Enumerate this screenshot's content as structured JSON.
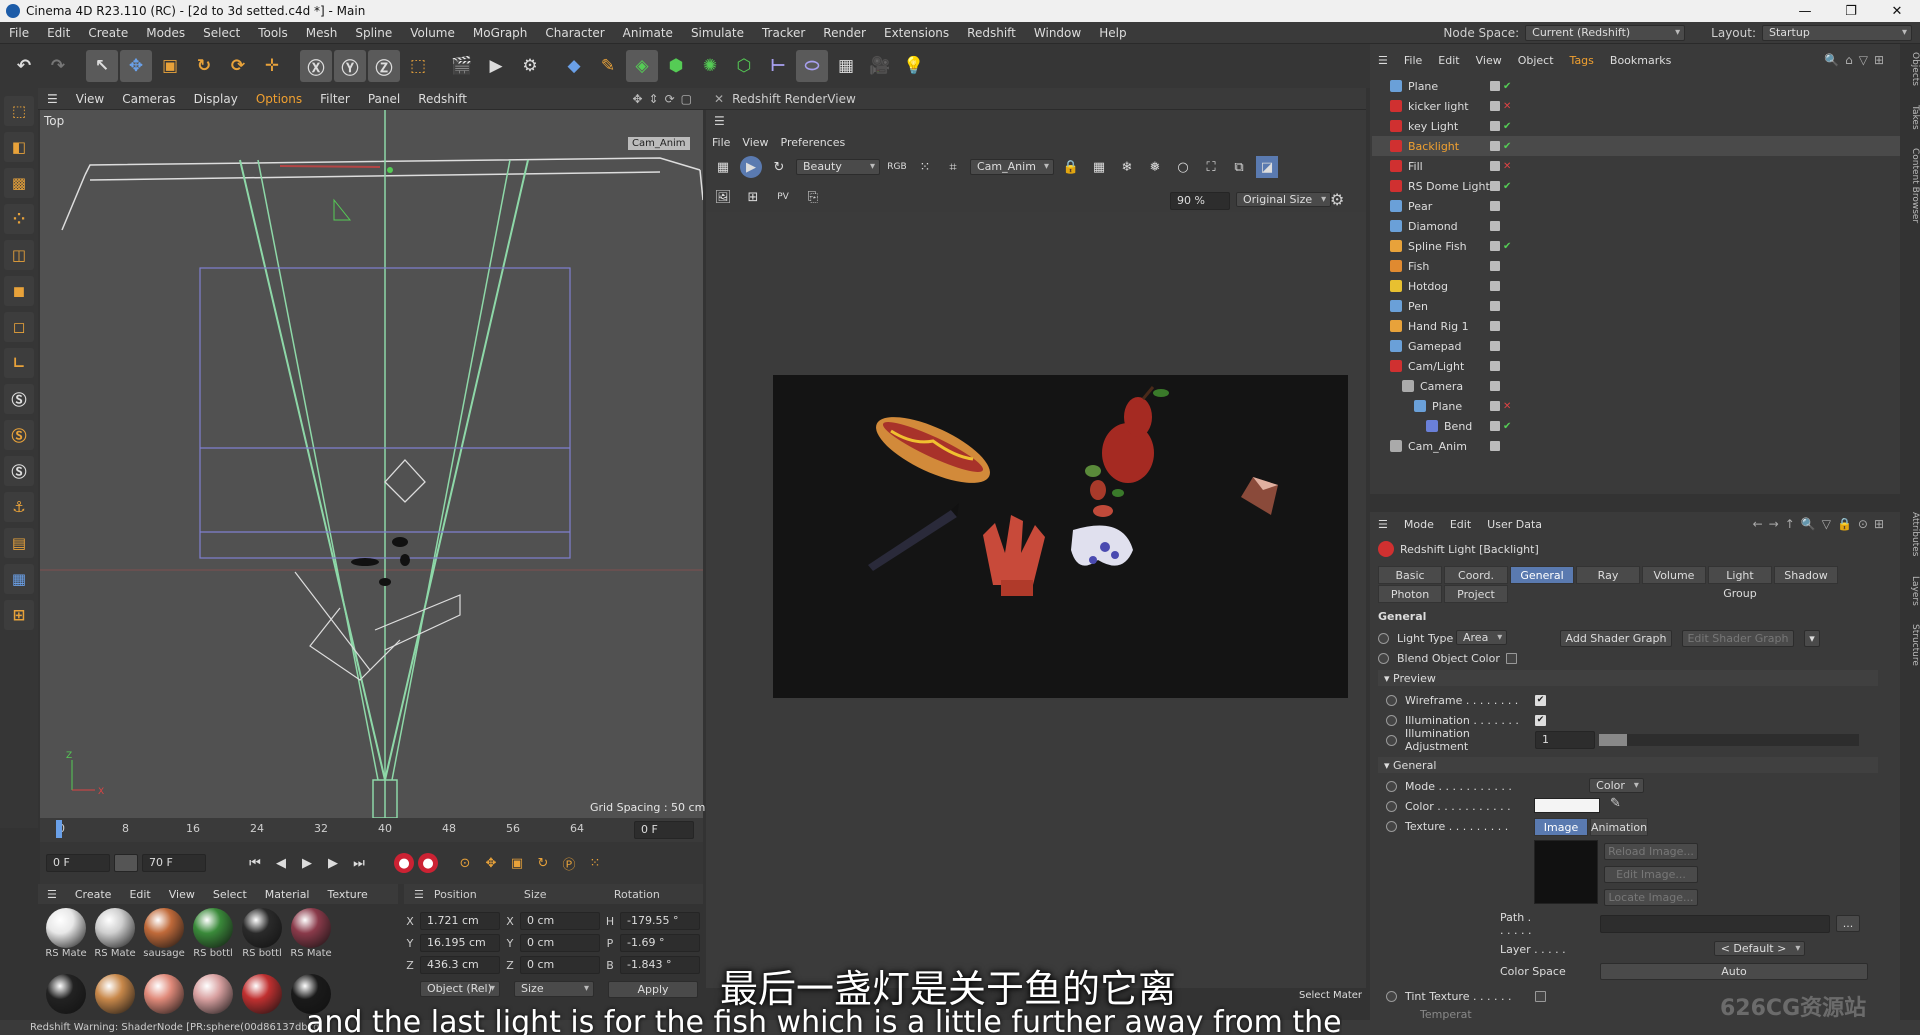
{
  "window": {
    "title": "Cinema 4D R23.110 (RC) - [2d to 3d setted.c4d *] - Main",
    "controls": [
      "—",
      "❐",
      "✕"
    ]
  },
  "menubar": {
    "items": [
      "File",
      "Edit",
      "Create",
      "Modes",
      "Select",
      "Tools",
      "Mesh",
      "Spline",
      "Volume",
      "MoGraph",
      "Character",
      "Animate",
      "Simulate",
      "Tracker",
      "Render",
      "Extensions",
      "Redshift",
      "Window",
      "Help"
    ],
    "node_space_label": "Node Space:",
    "node_space_value": "Current (Redshift)",
    "layout_label": "Layout:",
    "layout_value": "Startup"
  },
  "viewport": {
    "menu": [
      "View",
      "Cameras",
      "Display",
      "Options",
      "Filter",
      "Panel",
      "Redshift"
    ],
    "view_name": "Top",
    "camera_label": "Cam_Anim",
    "grid_spacing": "Grid Spacing : 50 cm"
  },
  "timeline": {
    "ticks": [
      "0",
      "8",
      "16",
      "24",
      "32",
      "40",
      "48",
      "56",
      "64"
    ],
    "current_frame": "0 F",
    "start_field": "0 F",
    "end_field": "70 F",
    "end_field2": "0 F"
  },
  "materials": {
    "menu": [
      "Create",
      "Edit",
      "View",
      "Select",
      "Material",
      "Texture"
    ],
    "items": [
      {
        "label": "RS Mate",
        "color": "#e8e8e8"
      },
      {
        "label": "RS Mate",
        "color": "#cfcfcf"
      },
      {
        "label": "sausage",
        "color": "#c06a3a"
      },
      {
        "label": "RS bottl",
        "color": "#3a8a3a"
      },
      {
        "label": "RS bottl",
        "color": "#2a2a2a"
      },
      {
        "label": "RS Mate",
        "color": "#8a3a4a"
      },
      {
        "label": "",
        "color": "#222222"
      },
      {
        "label": "",
        "color": "#c8884a"
      },
      {
        "label": "",
        "color": "#e08a7a"
      },
      {
        "label": "",
        "color": "#d8a0a0"
      },
      {
        "label": "",
        "color": "#c03030"
      },
      {
        "label": "",
        "color": "#1a1a1a"
      }
    ]
  },
  "coords": {
    "headers": [
      "Position",
      "Size",
      "Rotation"
    ],
    "rows": [
      {
        "a": "X",
        "p": "1.721 cm",
        "b": "X",
        "s": "0 cm",
        "c": "H",
        "r": "-179.55 °"
      },
      {
        "a": "Y",
        "p": "16.195 cm",
        "b": "Y",
        "s": "0 cm",
        "c": "P",
        "r": "-1.69 °"
      },
      {
        "a": "Z",
        "p": "436.3 cm",
        "b": "Z",
        "s": "0 cm",
        "c": "B",
        "r": "-1.843 °"
      }
    ],
    "mode1": "Object (Rel)",
    "mode2": "Size",
    "apply": "Apply"
  },
  "renderview": {
    "title": "Redshift RenderView",
    "menu": [
      "File",
      "View",
      "Preferences"
    ],
    "aov": "Beauty",
    "camera": "Cam_Anim",
    "zoom": "90 %",
    "size": "Original Size",
    "bottom_label": "Select Mater"
  },
  "objects": {
    "menu": [
      "File",
      "Edit",
      "View",
      "Object",
      "Tags",
      "Bookmarks"
    ],
    "rows": [
      {
        "name": "Plane",
        "indent": 0,
        "color": "#6aa0d8"
      },
      {
        "name": "kicker light",
        "indent": 0,
        "color": "#d03030"
      },
      {
        "name": "key Light",
        "indent": 0,
        "color": "#d03030"
      },
      {
        "name": "Backlight",
        "indent": 0,
        "color": "#d03030"
      },
      {
        "name": "Fill",
        "indent": 0,
        "color": "#d03030"
      },
      {
        "name": "RS Dome Light",
        "indent": 0,
        "color": "#d03030"
      },
      {
        "name": "Pear",
        "indent": 0,
        "color": "#6aa0d8"
      },
      {
        "name": "Diamond",
        "indent": 0,
        "color": "#6aa0d8"
      },
      {
        "name": "Spline Fish",
        "indent": 0,
        "color": "#e8a23a"
      },
      {
        "name": "Fish",
        "indent": 0,
        "color": "#e08a30"
      },
      {
        "name": "Hotdog",
        "indent": 0,
        "color": "#e8c030"
      },
      {
        "name": "Pen",
        "indent": 0,
        "color": "#6aa0d8"
      },
      {
        "name": "Hand Rig 1",
        "indent": 0,
        "color": "#e8a23a"
      },
      {
        "name": "Gamepad",
        "indent": 0,
        "color": "#6aa0d8"
      },
      {
        "name": "Cam/Light",
        "indent": 0,
        "color": "#d03030"
      },
      {
        "name": "Camera",
        "indent": 1,
        "color": "#aaaaaa"
      },
      {
        "name": "Plane",
        "indent": 2,
        "color": "#6aa0d8"
      },
      {
        "name": "Bend",
        "indent": 3,
        "color": "#6a80d8"
      },
      {
        "name": "Cam_Anim",
        "indent": 0,
        "color": "#aaaaaa"
      }
    ]
  },
  "attributes": {
    "menu": [
      "Mode",
      "Edit",
      "User Data"
    ],
    "title": "Redshift Light [Backlight]",
    "tabs_row1": [
      "Basic",
      "Coord.",
      "General",
      "Ray",
      "Volume",
      "Light Group",
      "Shadow"
    ],
    "tabs_row2": [
      "Photon",
      "Project"
    ],
    "section_general": "General",
    "light_type_label": "Light Type",
    "light_type_value": "Area",
    "add_shader_graph": "Add Shader Graph",
    "edit_shader_graph": "Edit Shader Graph",
    "blend_object_color": "Blend Object Color",
    "preview_section": "Preview",
    "wireframe": "Wireframe . . . . . . . .",
    "illumination": "Illumination . . . . . . .",
    "illumination_adj": "Illumination Adjustment",
    "illumination_adj_value": "1",
    "general_section": "General",
    "mode_label": "Mode . . . . . . . . . . .",
    "mode_value": "Color",
    "color_label": "Color . . . . . . . . . . .",
    "texture_label": "Texture . . . . . . . . .",
    "image_tab": "Image",
    "animation_tab": "Animation",
    "reload_image": "Reload Image...",
    "edit_image": "Edit Image...",
    "locate_image": "Locate Image...",
    "path_label": "Path . . . . . .",
    "layer_label": "Layer . . . . .",
    "layer_value": "< Default >",
    "colorspace_label": "Color Space",
    "colorspace_value": "Auto",
    "tint_texture": "Tint Texture . . . . . .",
    "temperature": "Temperat"
  },
  "side_tabs": [
    "Objects",
    "Takes",
    "Content Browser",
    "Attributes",
    "Layers",
    "Structure"
  ],
  "status": "Redshift Warning: ShaderNode [PR:sphere(00d86137dbcd",
  "subtitles": {
    "cn": "最后一盏灯是关于鱼的它离",
    "en": "and the last light is for the fish which is a little further away from the"
  },
  "watermark": "626CG资源站",
  "colors": {
    "accent": "#f0a030",
    "selection": "#5a7ab0",
    "bg": "#333333"
  }
}
